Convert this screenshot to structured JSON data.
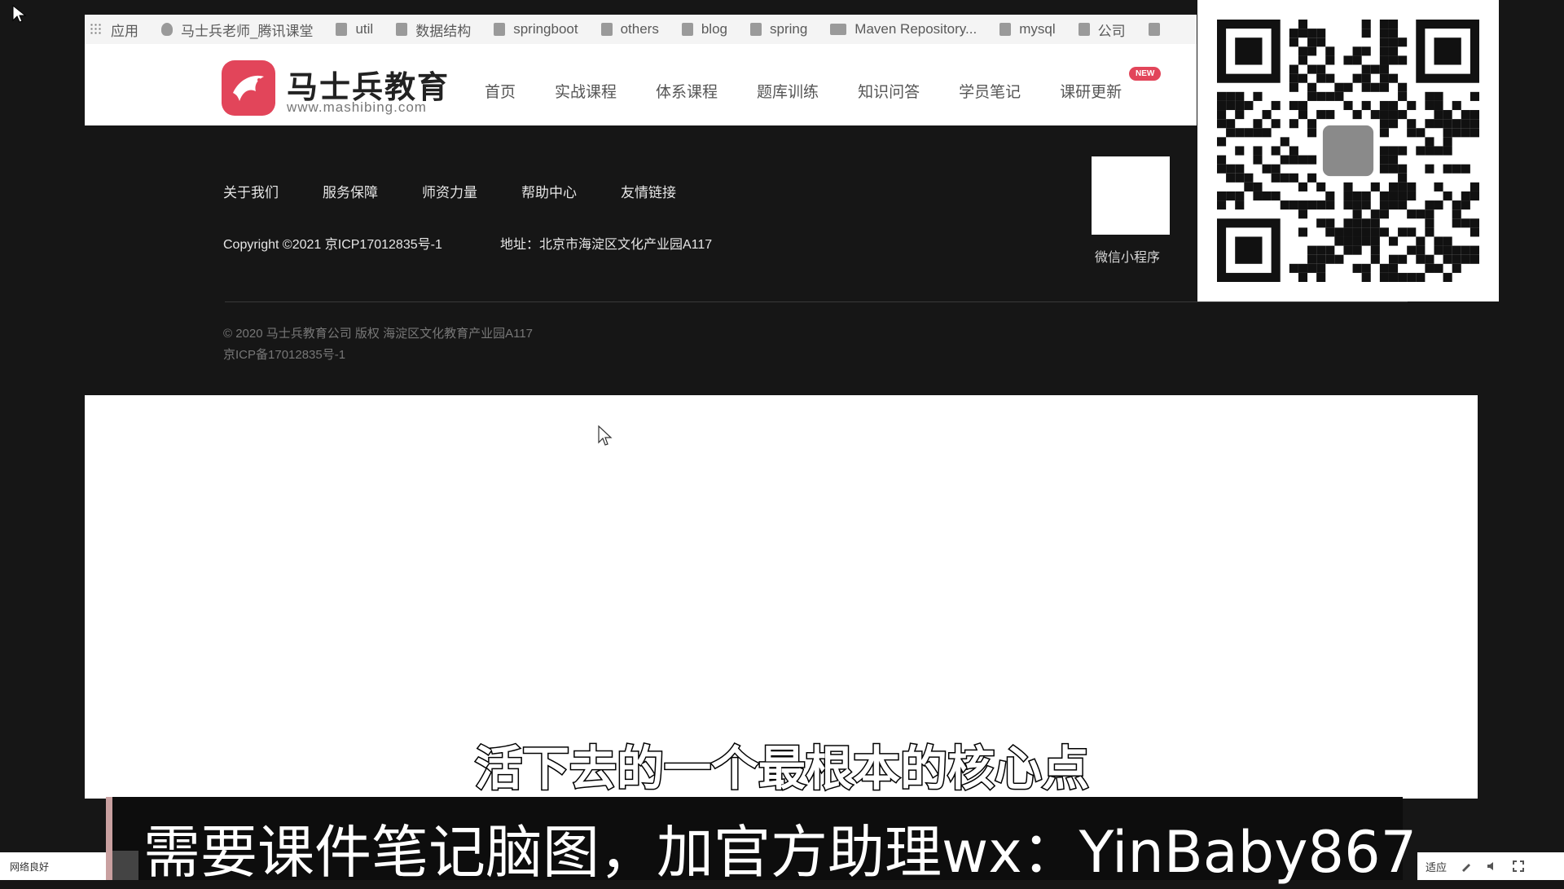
{
  "bookmarks": [
    {
      "label": "应用",
      "icon": "apps-grid-icon"
    },
    {
      "label": "马士兵老师_腾讯课堂",
      "icon": "shield-icon"
    },
    {
      "label": "util",
      "icon": "folder-icon"
    },
    {
      "label": "数据结构",
      "icon": "folder-icon"
    },
    {
      "label": "springboot",
      "icon": "folder-icon"
    },
    {
      "label": "others",
      "icon": "folder-icon"
    },
    {
      "label": "blog",
      "icon": "folder-icon"
    },
    {
      "label": "spring",
      "icon": "folder-icon"
    },
    {
      "label": "Maven Repository...",
      "icon": "maven-icon"
    },
    {
      "label": "mysql",
      "icon": "folder-icon"
    },
    {
      "label": "公司",
      "icon": "folder-icon"
    }
  ],
  "header": {
    "logo_title": "马士兵教育",
    "logo_url": "www.mashibing.com",
    "nav": [
      "首页",
      "实战课程",
      "体系课程",
      "题库训练",
      "知识问答",
      "学员笔记",
      "课研更新"
    ],
    "new_badge": "NEW"
  },
  "footer": {
    "links": [
      "关于我们",
      "服务保障",
      "师资力量",
      "帮助中心",
      "友情链接"
    ],
    "copyright": "Copyright ©2021 京ICP17012835号-1",
    "address": "地址：北京市海淀区文化产业园A117",
    "mini_program_label": "微信小程序",
    "copy2": "© 2020 马士兵教育公司 版权    海淀区文化教育产业园A117",
    "icp2": "京ICP备17012835号-1"
  },
  "subtitle": "活下去的一个最根本的核心点",
  "ad_text": "需要课件笔记脑图，加官方助理wx：YinBaby867",
  "taskbar": {
    "left_label": "网络良好",
    "right_label": "适应"
  },
  "colors": {
    "brand": "#e2455a",
    "background": "#161616"
  }
}
